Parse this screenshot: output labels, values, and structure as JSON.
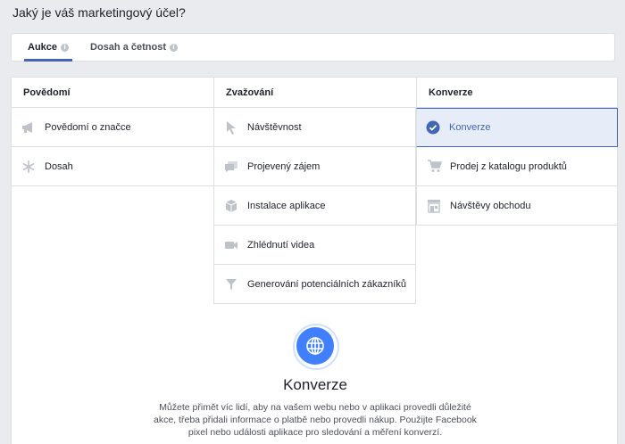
{
  "header": {
    "title": "Jaký je váš marketingový účel?"
  },
  "tabs": [
    {
      "label": "Aukce",
      "active": true
    },
    {
      "label": "Dosah a četnost",
      "active": false
    }
  ],
  "columns": [
    {
      "title": "Povědomí",
      "items": [
        {
          "label": "Povědomí o značce",
          "icon": "megaphone-icon"
        },
        {
          "label": "Dosah",
          "icon": "snowflake-icon"
        }
      ]
    },
    {
      "title": "Zvažování",
      "items": [
        {
          "label": "Návštěvnost",
          "icon": "cursor-icon"
        },
        {
          "label": "Projevený zájem",
          "icon": "speech-bubbles-icon"
        },
        {
          "label": "Instalace aplikace",
          "icon": "box-icon"
        },
        {
          "label": "Zhlédnutí videa",
          "icon": "video-camera-icon"
        },
        {
          "label": "Generování potenciálních zákazníků",
          "icon": "funnel-icon"
        }
      ]
    },
    {
      "title": "Konverze",
      "items": [
        {
          "label": "Konverze",
          "icon": "globe-check-icon",
          "selected": true
        },
        {
          "label": "Prodej z katalogu produktů",
          "icon": "cart-icon"
        },
        {
          "label": "Návštěvy obchodu",
          "icon": "store-icon"
        }
      ]
    }
  ],
  "detail": {
    "icon": "globe-icon",
    "title": "Konverze",
    "description": "Můžete přimět víc lidí, aby na vašem webu nebo v aplikaci provedli důležité akce, třeba přidali informace o platbě nebo provedli nákup. Použijte Facebook pixel nebo události aplikace pro sledování a měření konverzí."
  },
  "colors": {
    "accent": "#4267b2",
    "selected_bg": "#e7edf8",
    "icon_gray": "#bec3c9",
    "detail_icon": "#4080ff"
  }
}
